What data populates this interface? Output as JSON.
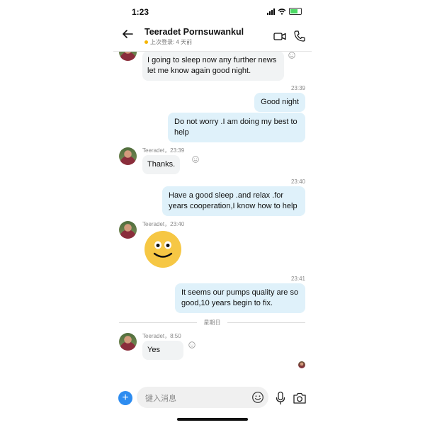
{
  "status": {
    "time": "1:23"
  },
  "header": {
    "name": "Teeradet Pornsuwankul",
    "last_seen": "上次登录: 4 天前"
  },
  "messages": {
    "m1": {
      "text": "I going to sleep now any further news let me know again good night."
    },
    "t1": "23:39",
    "m2": {
      "text": "Good night"
    },
    "m3": {
      "text": "Do not worry .I am doing my best to help"
    },
    "m4": {
      "meta": "Teeradet，23:39",
      "text": "Thanks."
    },
    "t2": "23:40",
    "m5": {
      "text": "Have a good sleep .and relax .for years cooperation,I know how to help"
    },
    "m6": {
      "meta": "Teeradet，23:40",
      "emoji": "smiley-face"
    },
    "t3": "23:41",
    "m7": {
      "text": "It seems our pumps quality are so good,10 years begin to fix."
    },
    "day_divider": "星期日",
    "m8": {
      "meta": "Teeradet，8:50",
      "text": "Yes"
    }
  },
  "composer": {
    "placeholder": "键入消息"
  },
  "colors": {
    "incoming_bubble": "#f1f3f4",
    "outgoing_bubble": "#dff1fa",
    "accent": "#2d8cf0",
    "presence_away": "#f5b400"
  }
}
